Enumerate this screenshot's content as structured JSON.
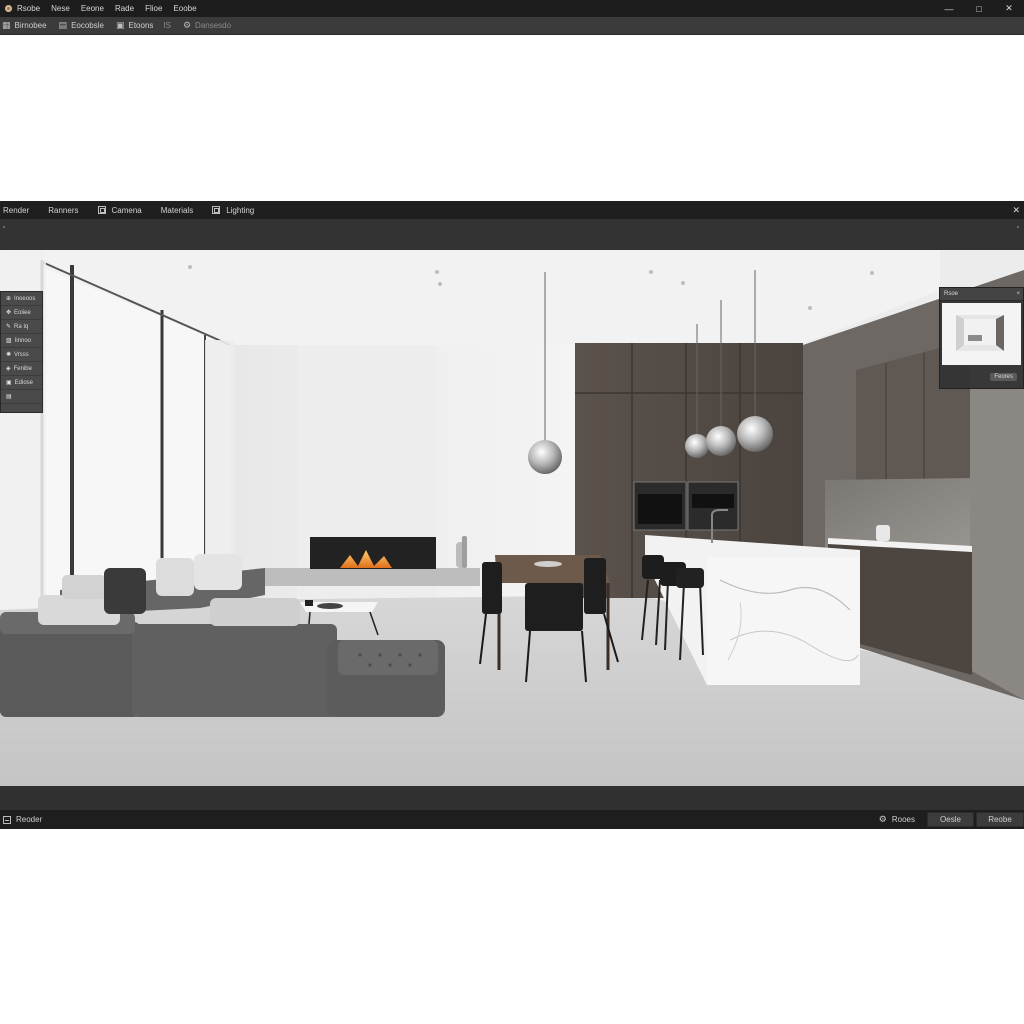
{
  "topbar": {
    "menu": [
      "Rsobe",
      "Nese",
      "Eeone",
      "Rade",
      "Flioe",
      "Eoobe"
    ],
    "window_controls": {
      "minimize": "—",
      "maximize": "□",
      "close": "✕"
    }
  },
  "toolbar": {
    "items": [
      {
        "icon": "grid-icon",
        "glyph": "▦",
        "label": "Birnobee"
      },
      {
        "icon": "list-icon",
        "glyph": "▤",
        "label": "Eocobsle"
      },
      {
        "icon": "panel-icon",
        "glyph": "▣",
        "label": "Etoons"
      },
      {
        "icon": "settings-icon",
        "glyph": "⚙",
        "label": "Dansesdo",
        "dim": true
      }
    ],
    "separator_label": "IS"
  },
  "render_window": {
    "tabs": [
      {
        "label": "Render",
        "has_icon": false
      },
      {
        "label": "Ranners",
        "has_icon": false
      },
      {
        "label": "Camena",
        "has_icon": true
      },
      {
        "label": "Materials",
        "has_icon": false
      },
      {
        "label": "Lighting",
        "has_icon": true
      }
    ],
    "close_glyph": "✕",
    "tool_palette": [
      {
        "icon": "select-icon",
        "glyph": "⊕",
        "label": "Inoeoos"
      },
      {
        "icon": "move-icon",
        "glyph": "✥",
        "label": "Eoiiee"
      },
      {
        "icon": "pen-icon",
        "glyph": "✎",
        "label": "Ra Iq"
      },
      {
        "icon": "image-icon",
        "glyph": "▨",
        "label": "Iinnoo"
      },
      {
        "icon": "light-icon",
        "glyph": "✺",
        "label": "Vrsss"
      },
      {
        "icon": "render-tool-icon",
        "glyph": "◈",
        "label": "Fenibe"
      },
      {
        "icon": "camera-tool-icon",
        "glyph": "▣",
        "label": "Ediose"
      },
      {
        "icon": "layers-icon",
        "glyph": "▤",
        "label": ""
      }
    ],
    "preview_panel": {
      "title": "Rsoe",
      "button": "Feores"
    },
    "status": {
      "left_label": "Reoder",
      "right_label": "Rooes",
      "buttons": [
        "Oesle",
        "Reobe"
      ]
    }
  }
}
